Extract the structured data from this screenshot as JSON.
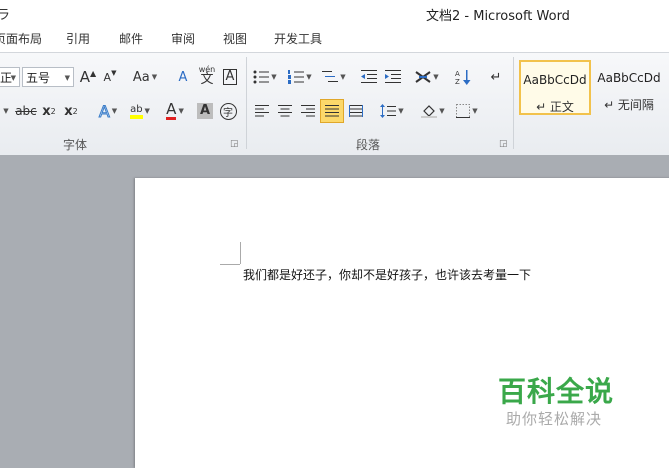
{
  "window": {
    "lead_glyph": "ラ",
    "title": "文档2 - Microsoft Word"
  },
  "tabs": [
    {
      "label": "页面布局"
    },
    {
      "label": "引用"
    },
    {
      "label": "邮件"
    },
    {
      "label": "审阅"
    },
    {
      "label": "视图"
    },
    {
      "label": "开发工具"
    }
  ],
  "font_group": {
    "label": "字体",
    "font_name_value": "正",
    "font_size_value": "五号",
    "grow_font": "A",
    "shrink_font": "A",
    "change_case": "Aa",
    "strikethrough": "abc",
    "subscript": "x",
    "superscript": "x",
    "subscript_mark": "2",
    "superscript_mark": "2",
    "text_effect": "A",
    "highlight": "ab",
    "font_color": "A",
    "char_shading": "A",
    "enclose_char": "字",
    "clear_format": "A",
    "phonetic_top": "wén",
    "phonetic_char": "文",
    "border_char": "A"
  },
  "paragraph_group": {
    "label": "段落"
  },
  "styles": [
    {
      "sample": "AaBbCcDd",
      "name": "↵ 正文"
    },
    {
      "sample": "AaBbCcDd",
      "name": "↵ 无间隔"
    }
  ],
  "document": {
    "text": "我们都是好还子，你却不是好孩子，也许该去考量一下"
  },
  "watermark": {
    "title": "百科全说",
    "subtitle": "助你轻松解决"
  },
  "colors": {
    "highlight": "#ffff00",
    "font_color": "#e02020",
    "watermark": "#3aa84a",
    "active_align": "#fcd86a"
  }
}
